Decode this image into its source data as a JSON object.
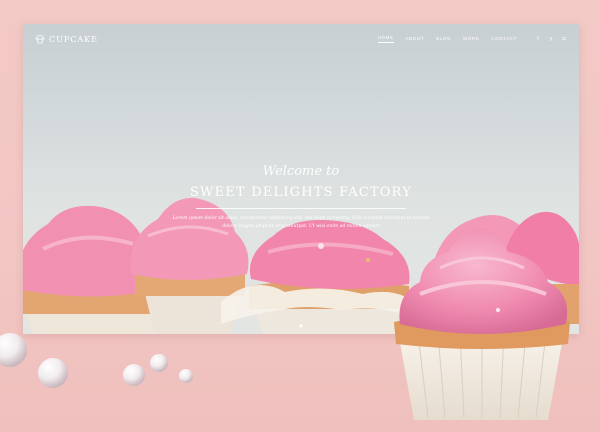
{
  "brand": {
    "name": "CUPCAKE"
  },
  "nav": {
    "items": [
      {
        "label": "HOME",
        "active": true
      },
      {
        "label": "ABOUT",
        "active": false
      },
      {
        "label": "BLOG",
        "active": false
      },
      {
        "label": "WORK",
        "active": false
      },
      {
        "label": "CONTACT",
        "active": false
      }
    ],
    "social_icons": [
      "facebook-icon",
      "twitter-icon",
      "instagram-icon"
    ],
    "social_glyphs": [
      "f",
      "y",
      "◘"
    ]
  },
  "hero": {
    "welcome": "Welcome to",
    "headline": "SWEET DELIGHTS FACTORY",
    "lead": "Lorem ipsum dolor sit amet, consectetur adipiscing elit, sed diam nonummy nibh euismod tincidunt ut laoreet dolore magna aliquam erat volutpat. Ut wisi enim ad minim veniam"
  },
  "colors": {
    "page_background": "#f3c9c6",
    "frosting": "#f28fb0",
    "cake": "#e8a46a",
    "liner": "#f3ede2"
  }
}
